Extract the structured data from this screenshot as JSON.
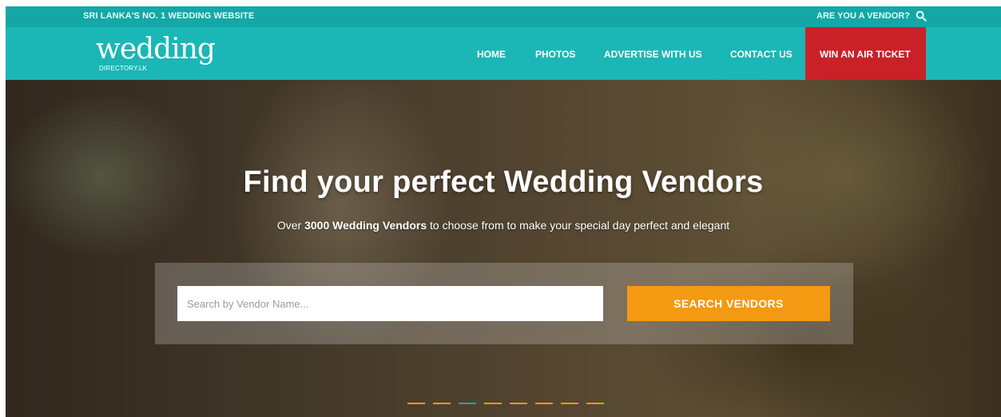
{
  "topbar": {
    "tagline": "SRI LANKA'S NO. 1 WEDDING WEBSITE",
    "vendor_link": "ARE YOU A VENDOR?",
    "search_icon": "search-icon"
  },
  "logo": {
    "word": "wedding",
    "sub": "DIRECTORY.LK"
  },
  "nav": {
    "items": [
      {
        "label": "HOME"
      },
      {
        "label": "PHOTOS"
      },
      {
        "label": "ADVERTISE WITH US"
      },
      {
        "label": "CONTACT US"
      }
    ],
    "cta": "WIN AN AIR TICKET"
  },
  "hero": {
    "title": "Find your perfect Wedding Vendors",
    "subtitle_pre": "Over ",
    "subtitle_bold": "3000 Wedding Vendors",
    "subtitle_post": " to choose from to make your special day perfect and elegant",
    "search_placeholder": "Search by Vendor Name...",
    "search_value": "",
    "search_button": "SEARCH VENDORS",
    "slides_total": 8,
    "active_slide": 3
  },
  "colors": {
    "teal": "#1ab7b6",
    "teal_dark": "#14a7a6",
    "cta_red": "#c92127",
    "orange": "#f39a12"
  }
}
